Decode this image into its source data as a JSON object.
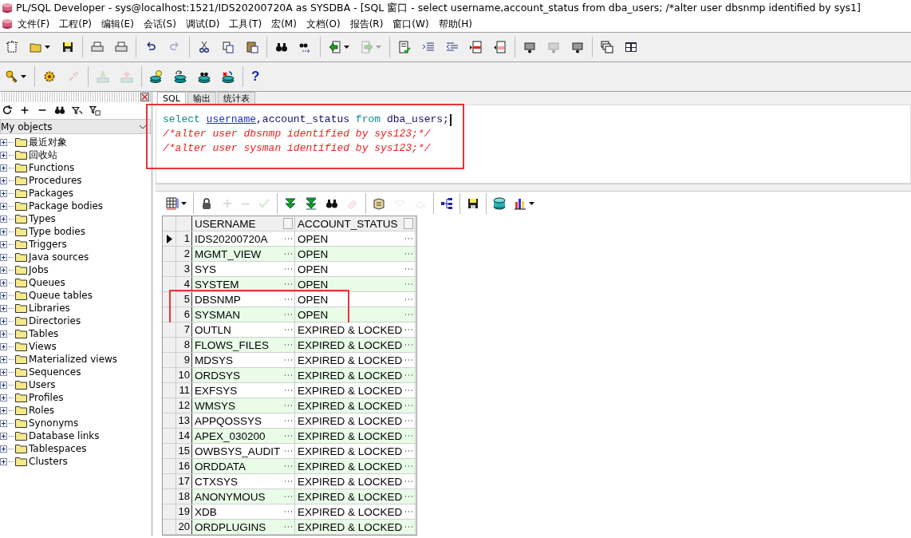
{
  "window": {
    "title": "PL/SQL Developer - sys@localhost:1521/IDS20200720A as SYSDBA - [SQL 窗口 - select username,account_status from dba_users; /*alter user dbsnmp identified by sys1]"
  },
  "menu": [
    "文件(F)",
    "工程(P)",
    "编辑(E)",
    "会话(S)",
    "调试(D)",
    "工具(T)",
    "宏(M)",
    "文档(O)",
    "报告(R)",
    "窗口(W)",
    "帮助(H)"
  ],
  "toolbar_main": [
    {
      "kind": "button",
      "disabled": false
    },
    {
      "kind": "button",
      "disabled": false,
      "dropdown": true
    },
    {
      "kind": "button",
      "disabled": false
    },
    {
      "kind": "separator"
    },
    {
      "kind": "button",
      "disabled": false
    },
    {
      "kind": "button",
      "disabled": false
    },
    {
      "kind": "separator"
    },
    {
      "kind": "button",
      "disabled": false
    },
    {
      "kind": "button",
      "disabled": true
    },
    {
      "kind": "separator"
    },
    {
      "kind": "button",
      "disabled": false
    },
    {
      "kind": "button",
      "disabled": false
    },
    {
      "kind": "button",
      "disabled": false
    },
    {
      "kind": "separator"
    },
    {
      "kind": "button",
      "disabled": false
    },
    {
      "kind": "button",
      "disabled": false
    },
    {
      "kind": "separator"
    },
    {
      "kind": "button",
      "disabled": false,
      "dropdown": true
    },
    {
      "kind": "button",
      "disabled": true,
      "dropdown": true
    },
    {
      "kind": "separator"
    },
    {
      "kind": "button",
      "disabled": false
    },
    {
      "kind": "button",
      "disabled": false
    },
    {
      "kind": "button",
      "disabled": false
    },
    {
      "kind": "button",
      "disabled": false
    },
    {
      "kind": "button",
      "disabled": false
    },
    {
      "kind": "separator"
    },
    {
      "kind": "button",
      "disabled": false
    },
    {
      "kind": "button",
      "disabled": true
    },
    {
      "kind": "button",
      "disabled": false
    },
    {
      "kind": "separator"
    },
    {
      "kind": "button",
      "disabled": false
    },
    {
      "kind": "button",
      "disabled": false
    }
  ],
  "toolbar_session": [
    {
      "kind": "button",
      "disabled": false,
      "dropdown": true
    },
    {
      "kind": "separator"
    },
    {
      "kind": "button",
      "disabled": false
    },
    {
      "kind": "button",
      "disabled": true
    },
    {
      "kind": "separator"
    },
    {
      "kind": "button",
      "disabled": true
    },
    {
      "kind": "button",
      "disabled": true
    },
    {
      "kind": "separator"
    },
    {
      "kind": "button",
      "disabled": false
    },
    {
      "kind": "button",
      "disabled": false
    },
    {
      "kind": "button",
      "disabled": false
    },
    {
      "kind": "button",
      "disabled": false
    },
    {
      "kind": "separator"
    },
    {
      "kind": "text",
      "label": "?",
      "disabled": false
    }
  ],
  "sidebar": {
    "tools": [
      {
        "kind": "button"
      },
      {
        "kind": "button"
      },
      {
        "kind": "button"
      },
      {
        "kind": "button"
      },
      {
        "kind": "button"
      },
      {
        "kind": "button"
      }
    ],
    "filter": "My objects",
    "items": [
      {
        "label": "最近对象",
        "expanded": false
      },
      {
        "label": "回收站",
        "expanded": false
      },
      {
        "label": "Functions",
        "expanded": false
      },
      {
        "label": "Procedures",
        "expanded": false
      },
      {
        "label": "Packages",
        "expanded": false
      },
      {
        "label": "Package bodies",
        "expanded": false
      },
      {
        "label": "Types",
        "expanded": false
      },
      {
        "label": "Type bodies",
        "expanded": false
      },
      {
        "label": "Triggers",
        "expanded": false
      },
      {
        "label": "Java sources",
        "expanded": false
      },
      {
        "label": "Jobs",
        "expanded": false
      },
      {
        "label": "Queues",
        "expanded": false
      },
      {
        "label": "Queue tables",
        "expanded": false
      },
      {
        "label": "Libraries",
        "expanded": false
      },
      {
        "label": "Directories",
        "expanded": false
      },
      {
        "label": "Tables",
        "expanded": false
      },
      {
        "label": "Views",
        "expanded": false
      },
      {
        "label": "Materialized views",
        "expanded": false
      },
      {
        "label": "Sequences",
        "expanded": false
      },
      {
        "label": "Users",
        "expanded": false
      },
      {
        "label": "Profiles",
        "expanded": false
      },
      {
        "label": "Roles",
        "expanded": false
      },
      {
        "label": "Synonyms",
        "expanded": false
      },
      {
        "label": "Database links",
        "expanded": false
      },
      {
        "label": "Tablespaces",
        "expanded": false
      },
      {
        "label": "Clusters",
        "expanded": false
      }
    ]
  },
  "tabs": [
    {
      "label": "SQL",
      "selected": true
    },
    {
      "label": "输出",
      "selected": false
    },
    {
      "label": "统计表",
      "selected": false
    }
  ],
  "editor": {
    "highlighted": true,
    "lines": [
      {
        "cursor": true,
        "tokens": [
          {
            "text": "select ",
            "kind": "keyword"
          },
          {
            "text": "username",
            "kind": "marked"
          },
          {
            "text": ",account_status ",
            "kind": "plain"
          },
          {
            "text": "from ",
            "kind": "keyword"
          },
          {
            "text": "dba_users;",
            "kind": "plain"
          }
        ]
      },
      {
        "cursor": false,
        "tokens": [
          {
            "text": "/*alter user dbsnmp identified by sys123;*/",
            "kind": "comment"
          }
        ]
      },
      {
        "cursor": false,
        "tokens": [
          {
            "text": "/*alter user sysman identified by sys123;*/",
            "kind": "comment"
          }
        ]
      }
    ]
  },
  "grid_toolbar": [
    {
      "kind": "button",
      "disabled": false,
      "dropdown": true
    },
    {
      "kind": "separator"
    },
    {
      "kind": "button",
      "disabled": false
    },
    {
      "kind": "button",
      "disabled": true
    },
    {
      "kind": "button",
      "disabled": true
    },
    {
      "kind": "button",
      "disabled": true
    },
    {
      "kind": "separator"
    },
    {
      "kind": "button",
      "disabled": false
    },
    {
      "kind": "button",
      "disabled": false
    },
    {
      "kind": "button",
      "disabled": false
    },
    {
      "kind": "button",
      "disabled": true
    },
    {
      "kind": "separator"
    },
    {
      "kind": "button",
      "disabled": false
    },
    {
      "kind": "button",
      "disabled": true
    },
    {
      "kind": "button",
      "disabled": true
    },
    {
      "kind": "separator"
    },
    {
      "kind": "button",
      "disabled": false
    },
    {
      "kind": "separator"
    },
    {
      "kind": "button",
      "disabled": false
    },
    {
      "kind": "separator"
    },
    {
      "kind": "button",
      "disabled": false
    },
    {
      "kind": "button",
      "disabled": false,
      "dropdown": true
    }
  ],
  "table": {
    "columns": [
      "USERNAME",
      "ACCOUNT_STATUS"
    ],
    "rows": [
      {
        "n": "1",
        "cells": [
          "IDS20200720A",
          "OPEN"
        ],
        "current": true,
        "highlighted": false
      },
      {
        "n": "2",
        "cells": [
          "MGMT_VIEW",
          "OPEN"
        ],
        "current": false,
        "highlighted": false
      },
      {
        "n": "3",
        "cells": [
          "SYS",
          "OPEN"
        ],
        "current": false,
        "highlighted": false
      },
      {
        "n": "4",
        "cells": [
          "SYSTEM",
          "OPEN"
        ],
        "current": false,
        "highlighted": false
      },
      {
        "n": "5",
        "cells": [
          "DBSNMP",
          "OPEN"
        ],
        "current": false,
        "highlighted": true
      },
      {
        "n": "6",
        "cells": [
          "SYSMAN",
          "OPEN"
        ],
        "current": false,
        "highlighted": true
      },
      {
        "n": "7",
        "cells": [
          "OUTLN",
          "EXPIRED & LOCKED"
        ],
        "current": false,
        "highlighted": false
      },
      {
        "n": "8",
        "cells": [
          "FLOWS_FILES",
          "EXPIRED & LOCKED"
        ],
        "current": false,
        "highlighted": false
      },
      {
        "n": "9",
        "cells": [
          "MDSYS",
          "EXPIRED & LOCKED"
        ],
        "current": false,
        "highlighted": false
      },
      {
        "n": "10",
        "cells": [
          "ORDSYS",
          "EXPIRED & LOCKED"
        ],
        "current": false,
        "highlighted": false
      },
      {
        "n": "11",
        "cells": [
          "EXFSYS",
          "EXPIRED & LOCKED"
        ],
        "current": false,
        "highlighted": false
      },
      {
        "n": "12",
        "cells": [
          "WMSYS",
          "EXPIRED & LOCKED"
        ],
        "current": false,
        "highlighted": false
      },
      {
        "n": "13",
        "cells": [
          "APPQOSSYS",
          "EXPIRED & LOCKED"
        ],
        "current": false,
        "highlighted": false
      },
      {
        "n": "14",
        "cells": [
          "APEX_030200",
          "EXPIRED & LOCKED"
        ],
        "current": false,
        "highlighted": false
      },
      {
        "n": "15",
        "cells": [
          "OWBSYS_AUDIT",
          "EXPIRED & LOCKED"
        ],
        "current": false,
        "highlighted": false
      },
      {
        "n": "16",
        "cells": [
          "ORDDATA",
          "EXPIRED & LOCKED"
        ],
        "current": false,
        "highlighted": false
      },
      {
        "n": "17",
        "cells": [
          "CTXSYS",
          "EXPIRED & LOCKED"
        ],
        "current": false,
        "highlighted": false
      },
      {
        "n": "18",
        "cells": [
          "ANONYMOUS",
          "EXPIRED & LOCKED"
        ],
        "current": false,
        "highlighted": false
      },
      {
        "n": "19",
        "cells": [
          "XDB",
          "EXPIRED & LOCKED"
        ],
        "current": false,
        "highlighted": false
      },
      {
        "n": "20",
        "cells": [
          "ORDPLUGINS",
          "EXPIRED & LOCKED"
        ],
        "current": false,
        "highlighted": false
      }
    ]
  }
}
